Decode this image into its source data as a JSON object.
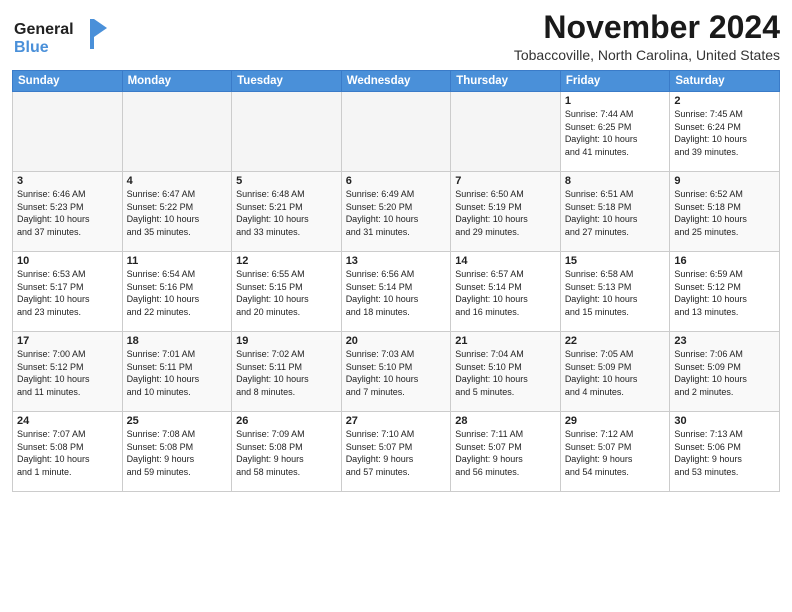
{
  "logo": {
    "line1": "General",
    "line2": "Blue"
  },
  "header": {
    "month": "November 2024",
    "location": "Tobaccoville, North Carolina, United States"
  },
  "weekdays": [
    "Sunday",
    "Monday",
    "Tuesday",
    "Wednesday",
    "Thursday",
    "Friday",
    "Saturday"
  ],
  "weeks": [
    [
      {
        "day": "",
        "info": ""
      },
      {
        "day": "",
        "info": ""
      },
      {
        "day": "",
        "info": ""
      },
      {
        "day": "",
        "info": ""
      },
      {
        "day": "",
        "info": ""
      },
      {
        "day": "1",
        "info": "Sunrise: 7:44 AM\nSunset: 6:25 PM\nDaylight: 10 hours\nand 41 minutes."
      },
      {
        "day": "2",
        "info": "Sunrise: 7:45 AM\nSunset: 6:24 PM\nDaylight: 10 hours\nand 39 minutes."
      }
    ],
    [
      {
        "day": "3",
        "info": "Sunrise: 6:46 AM\nSunset: 5:23 PM\nDaylight: 10 hours\nand 37 minutes."
      },
      {
        "day": "4",
        "info": "Sunrise: 6:47 AM\nSunset: 5:22 PM\nDaylight: 10 hours\nand 35 minutes."
      },
      {
        "day": "5",
        "info": "Sunrise: 6:48 AM\nSunset: 5:21 PM\nDaylight: 10 hours\nand 33 minutes."
      },
      {
        "day": "6",
        "info": "Sunrise: 6:49 AM\nSunset: 5:20 PM\nDaylight: 10 hours\nand 31 minutes."
      },
      {
        "day": "7",
        "info": "Sunrise: 6:50 AM\nSunset: 5:19 PM\nDaylight: 10 hours\nand 29 minutes."
      },
      {
        "day": "8",
        "info": "Sunrise: 6:51 AM\nSunset: 5:18 PM\nDaylight: 10 hours\nand 27 minutes."
      },
      {
        "day": "9",
        "info": "Sunrise: 6:52 AM\nSunset: 5:18 PM\nDaylight: 10 hours\nand 25 minutes."
      }
    ],
    [
      {
        "day": "10",
        "info": "Sunrise: 6:53 AM\nSunset: 5:17 PM\nDaylight: 10 hours\nand 23 minutes."
      },
      {
        "day": "11",
        "info": "Sunrise: 6:54 AM\nSunset: 5:16 PM\nDaylight: 10 hours\nand 22 minutes."
      },
      {
        "day": "12",
        "info": "Sunrise: 6:55 AM\nSunset: 5:15 PM\nDaylight: 10 hours\nand 20 minutes."
      },
      {
        "day": "13",
        "info": "Sunrise: 6:56 AM\nSunset: 5:14 PM\nDaylight: 10 hours\nand 18 minutes."
      },
      {
        "day": "14",
        "info": "Sunrise: 6:57 AM\nSunset: 5:14 PM\nDaylight: 10 hours\nand 16 minutes."
      },
      {
        "day": "15",
        "info": "Sunrise: 6:58 AM\nSunset: 5:13 PM\nDaylight: 10 hours\nand 15 minutes."
      },
      {
        "day": "16",
        "info": "Sunrise: 6:59 AM\nSunset: 5:12 PM\nDaylight: 10 hours\nand 13 minutes."
      }
    ],
    [
      {
        "day": "17",
        "info": "Sunrise: 7:00 AM\nSunset: 5:12 PM\nDaylight: 10 hours\nand 11 minutes."
      },
      {
        "day": "18",
        "info": "Sunrise: 7:01 AM\nSunset: 5:11 PM\nDaylight: 10 hours\nand 10 minutes."
      },
      {
        "day": "19",
        "info": "Sunrise: 7:02 AM\nSunset: 5:11 PM\nDaylight: 10 hours\nand 8 minutes."
      },
      {
        "day": "20",
        "info": "Sunrise: 7:03 AM\nSunset: 5:10 PM\nDaylight: 10 hours\nand 7 minutes."
      },
      {
        "day": "21",
        "info": "Sunrise: 7:04 AM\nSunset: 5:10 PM\nDaylight: 10 hours\nand 5 minutes."
      },
      {
        "day": "22",
        "info": "Sunrise: 7:05 AM\nSunset: 5:09 PM\nDaylight: 10 hours\nand 4 minutes."
      },
      {
        "day": "23",
        "info": "Sunrise: 7:06 AM\nSunset: 5:09 PM\nDaylight: 10 hours\nand 2 minutes."
      }
    ],
    [
      {
        "day": "24",
        "info": "Sunrise: 7:07 AM\nSunset: 5:08 PM\nDaylight: 10 hours\nand 1 minute."
      },
      {
        "day": "25",
        "info": "Sunrise: 7:08 AM\nSunset: 5:08 PM\nDaylight: 9 hours\nand 59 minutes."
      },
      {
        "day": "26",
        "info": "Sunrise: 7:09 AM\nSunset: 5:08 PM\nDaylight: 9 hours\nand 58 minutes."
      },
      {
        "day": "27",
        "info": "Sunrise: 7:10 AM\nSunset: 5:07 PM\nDaylight: 9 hours\nand 57 minutes."
      },
      {
        "day": "28",
        "info": "Sunrise: 7:11 AM\nSunset: 5:07 PM\nDaylight: 9 hours\nand 56 minutes."
      },
      {
        "day": "29",
        "info": "Sunrise: 7:12 AM\nSunset: 5:07 PM\nDaylight: 9 hours\nand 54 minutes."
      },
      {
        "day": "30",
        "info": "Sunrise: 7:13 AM\nSunset: 5:06 PM\nDaylight: 9 hours\nand 53 minutes."
      }
    ]
  ]
}
